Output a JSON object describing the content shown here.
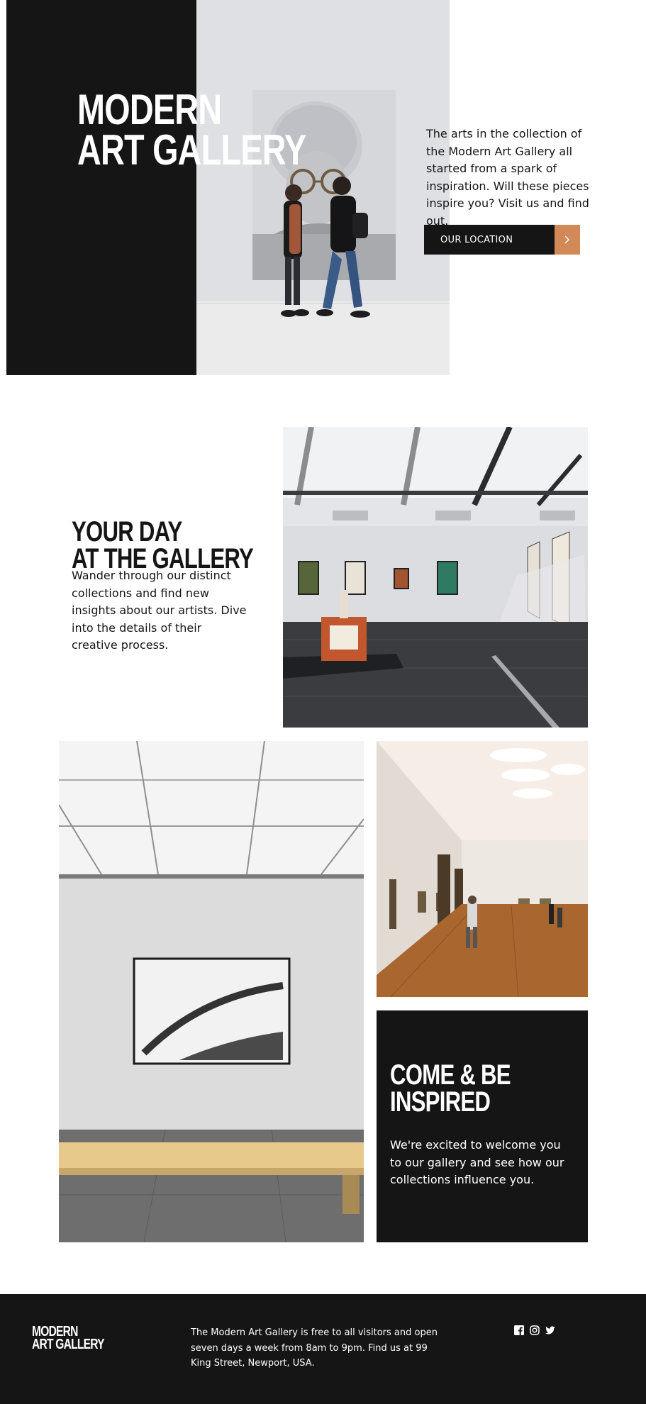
{
  "hero": {
    "title_line1": "Modern",
    "title_line2": "Art Gallery",
    "description": "The arts in the collection of the Modern Art Gallery all started from a spark of inspiration. Will these pieces inspire you? Visit us and find out.",
    "button_label": "Our Location",
    "button_icon": "chevron-right-icon",
    "image": "two visitors looking at a large portrait painting"
  },
  "day_section": {
    "title_line1": "Your Day",
    "title_line2": "At The Gallery",
    "description": "Wander through our distinct collections and find new insights about our artists. Dive into the details of their creative process.",
    "image": "gallery room with framed artworks and a sculpture"
  },
  "grid": {
    "image_left": "single framed photograph above a wooden bench",
    "image_right": "long gallery hall with wooden floor and visitors"
  },
  "inspired": {
    "title_line1": "Come & Be",
    "title_line2": "Inspired",
    "description": "We're excited to welcome you to our gallery and see how our collections influence you."
  },
  "footer": {
    "logo_line1": "Modern",
    "logo_line2": "Art Gallery",
    "text": "The Modern Art Gallery is free to all visitors and open seven days a week from 8am to 9pm. Find us at 99 King Street, Newport, USA.",
    "socials": [
      "facebook-icon",
      "instagram-icon",
      "twitter-icon"
    ]
  },
  "colors": {
    "dark": "#151515",
    "accent": "#d18a57",
    "white": "#ffffff"
  }
}
